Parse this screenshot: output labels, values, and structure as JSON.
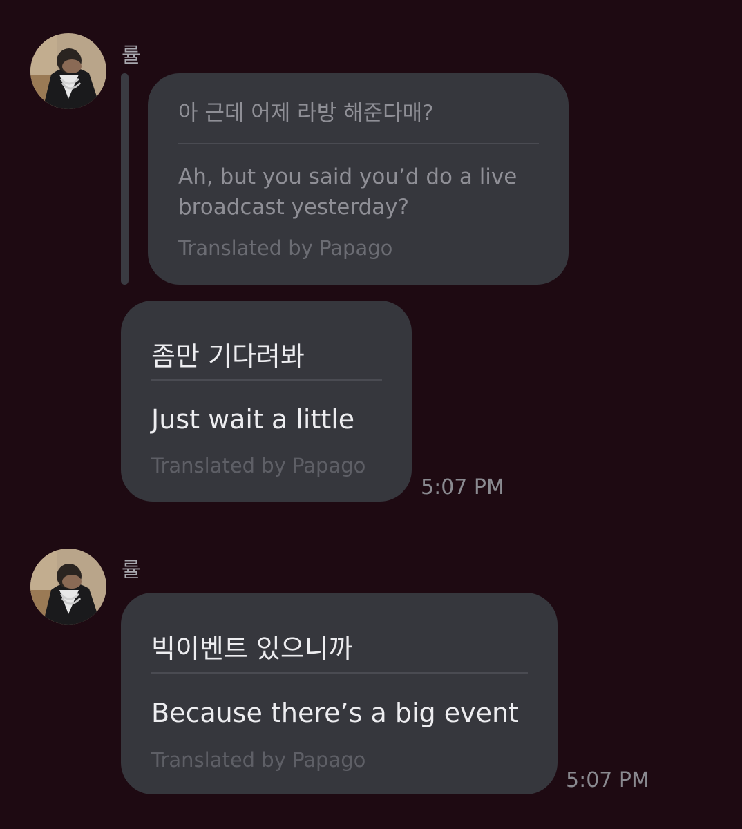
{
  "group1": {
    "sender_name": "률",
    "avatar": "user-avatar-photo",
    "quoted": {
      "original": "아 근데 어제 라방 해준다매?",
      "translation": "Ah, but you said you’d do a live broadcast yesterday?",
      "credit": "Translated by Papago"
    },
    "message": {
      "original": "좀만 기다려봐",
      "translation": "Just wait a little",
      "credit": "Translated by Papago",
      "time": "5:07 PM"
    }
  },
  "group2": {
    "sender_name": "률",
    "avatar": "user-avatar-photo",
    "message": {
      "original": "빅이벤트 있으니까",
      "translation": "Because there’s a big event",
      "credit": "Translated by Papago",
      "time": "5:07 PM"
    }
  },
  "colors": {
    "background": "#1e0a12",
    "bubble": "#36373d",
    "text_primary": "#ededf0",
    "text_secondary": "#8f8f96",
    "timestamp": "#8a8a90"
  }
}
